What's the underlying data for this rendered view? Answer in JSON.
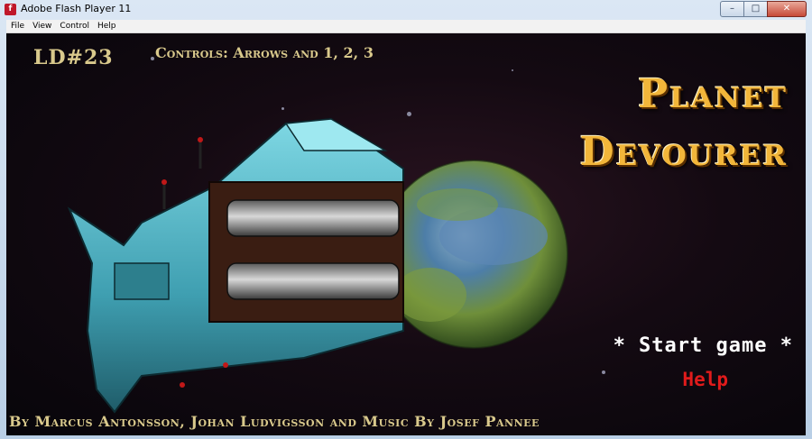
{
  "window": {
    "title": "Adobe Flash Player 11",
    "icon": "flash-icon",
    "buttons": {
      "minimize": "–",
      "maximize": "□",
      "close": "✕"
    }
  },
  "menu": [
    "File",
    "View",
    "Control",
    "Help"
  ],
  "game": {
    "jam_label": "LD#23",
    "controls": "Controls: Arrows and 1, 2, 3",
    "title_line1": "Planet",
    "title_line2": "Devourer",
    "start_label": "* Start game *",
    "help_label": "Help",
    "credits": "By Marcus Antonsson, Johan Ludvigsson and Music By Josef Pannee",
    "colors": {
      "title": "#f2b63a",
      "gold_text": "#d9c98c",
      "start": "#ffffff",
      "help": "#e11b1b",
      "ship": "#4fb3c4",
      "planet_green": "#6f8f3a",
      "planet_blue": "#3e6ea0"
    }
  }
}
